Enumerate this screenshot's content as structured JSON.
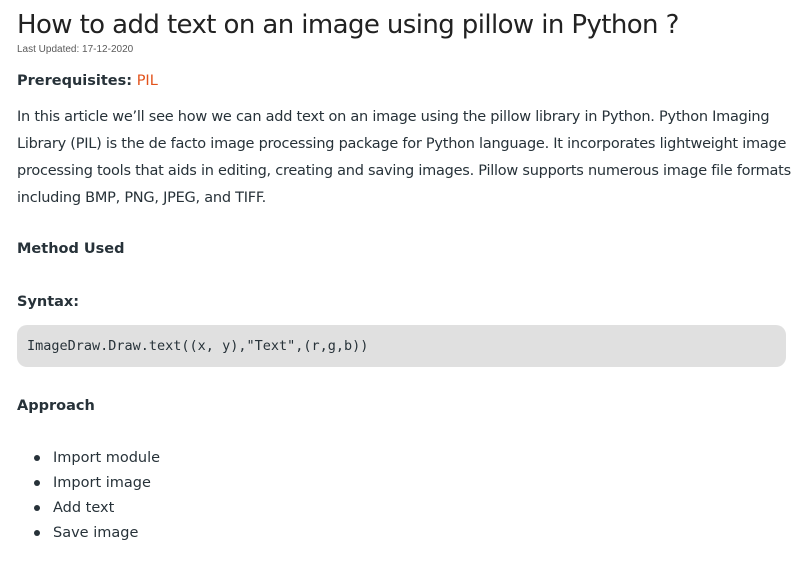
{
  "article": {
    "title": "How to add text on an image using pillow in Python ?",
    "last_updated": "Last Updated: 17-12-2020",
    "prerequisites_label": "Prerequisites:",
    "prerequisites_link": "PIL",
    "intro": "In this article we’ll see how we can add text on an image using the pillow library in Python. Python Imaging Library (PIL) is the de facto image processing package for Python language. It incorporates lightweight image processing tools that aids in editing, creating and saving images. Pillow supports numerous image file formats including BMP, PNG, JPEG, and TIFF.",
    "method_heading": "Method Used",
    "syntax_heading": "Syntax:",
    "syntax_code": "ImageDraw.Draw.text((x, y),\"Text\",(r,g,b))",
    "approach_heading": "Approach",
    "approach_steps": [
      "Import module",
      "Import image",
      "Add text",
      "Save image"
    ]
  },
  "colors": {
    "link": "#e2521b",
    "text": "#273239",
    "code_background": "#e0e0e0"
  }
}
